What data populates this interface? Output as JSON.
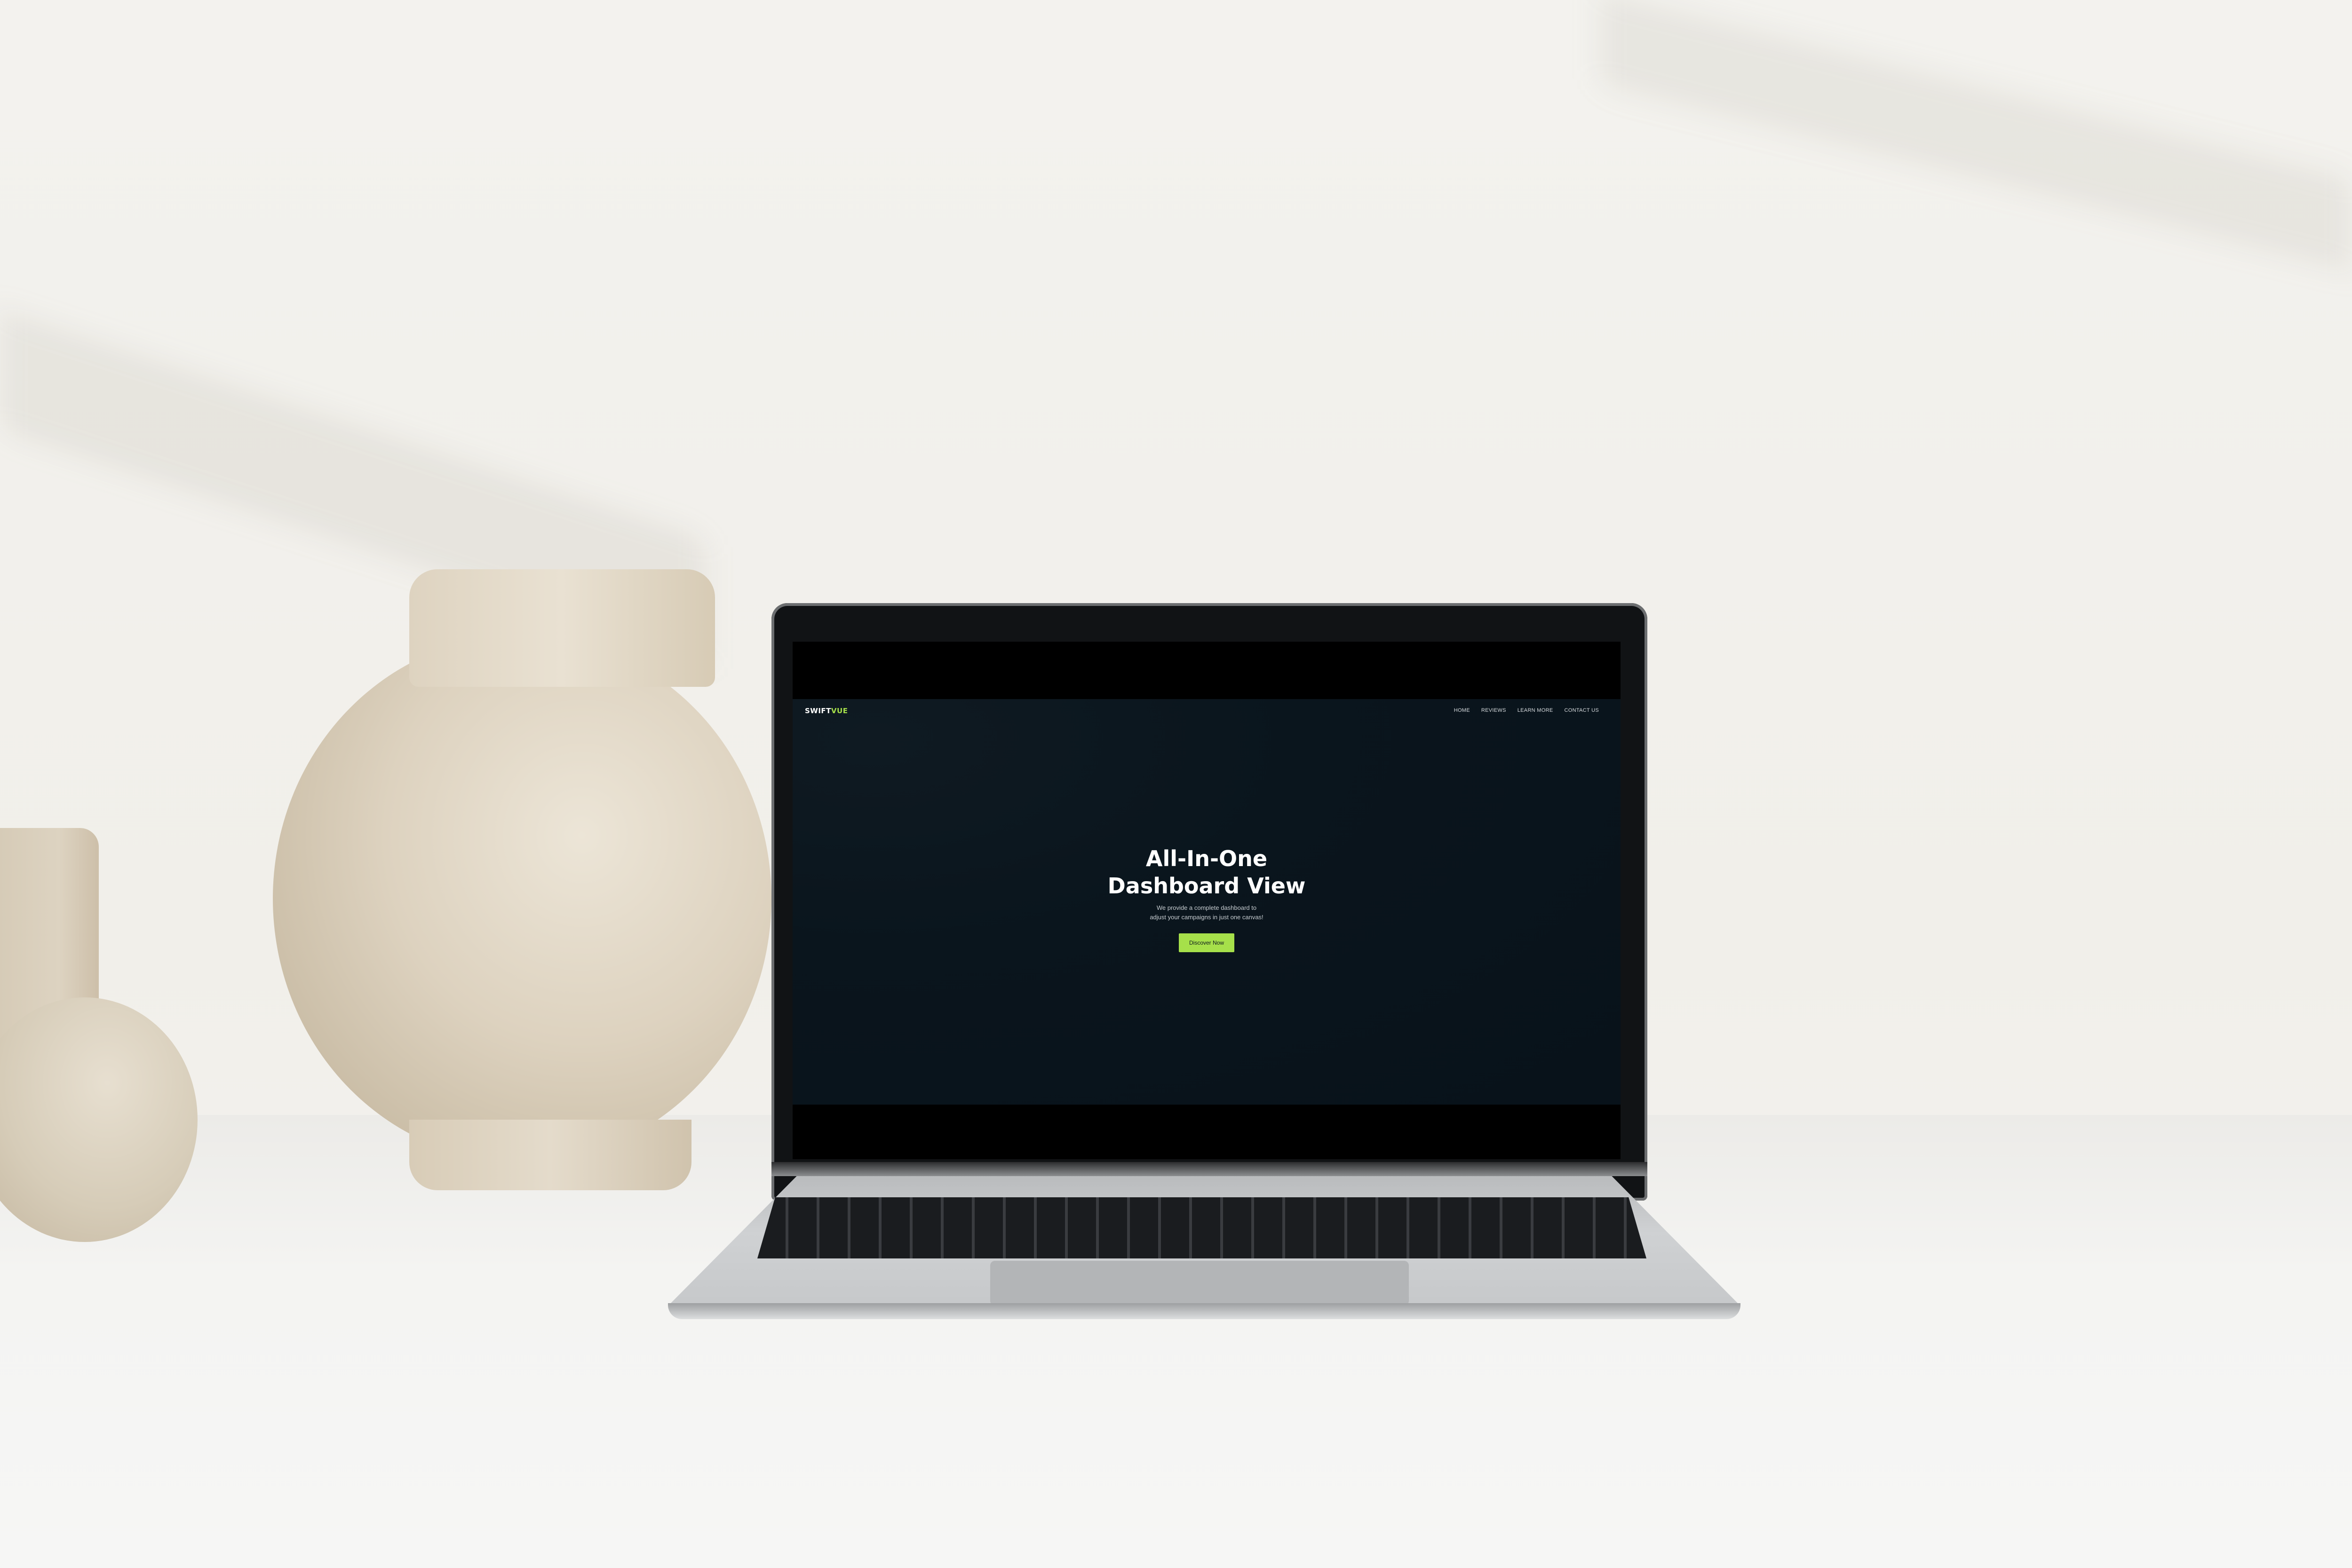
{
  "website": {
    "logo_part1": "SWIFT",
    "logo_part2": "VUE",
    "nav": [
      "HOME",
      "REVIEWS",
      "LEARN MORE",
      "CONTACT US"
    ],
    "hero_title_line1": "All-In-One",
    "hero_title_line2": "Dashboard View",
    "hero_sub_line1": "We provide a complete dashboard to",
    "hero_sub_line2": "adjust your campaigns in just one canvas!",
    "cta_label": "Discover Now",
    "accent_color": "#a6e04a",
    "background_color": "#08121a"
  }
}
